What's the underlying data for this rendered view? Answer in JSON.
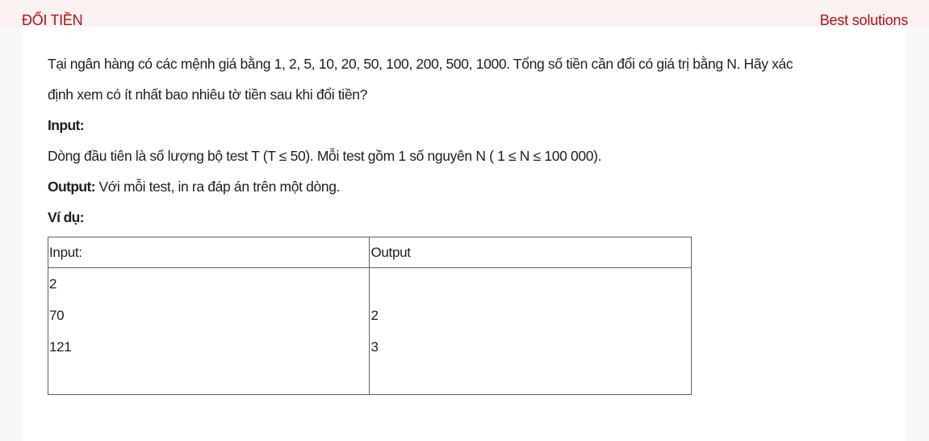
{
  "header": {
    "title": "ĐỔI TIỀN",
    "best_solutions_link": "Best solutions"
  },
  "problem": {
    "statement_line1": "Tại ngân hàng có các mệnh giá bằng 1, 2, 5, 10, 20, 50, 100, 200, 500, 1000. Tổng số tiền cần đổi có giá trị bằng N.  Hãy xác",
    "statement_line2": "định xem có ít nhất bao nhiêu tờ tiền sau khi đổi tiền?",
    "input_heading": "Input:",
    "input_text": "Dòng đầu tiên là số lượng bộ test T (T ≤ 50).  Mỗi test gồm 1 số nguyên N ( 1 ≤ N ≤ 100 000).",
    "output_heading": "Output:",
    "output_text": " Với mỗi test, in ra đáp án trên một dòng.",
    "example_heading": "Ví dụ:"
  },
  "example_table": {
    "headers": [
      "Input:",
      "Output"
    ],
    "input_lines": [
      "2",
      "70",
      "121",
      ""
    ],
    "output_lines": [
      "",
      "2",
      "3",
      ""
    ]
  }
}
